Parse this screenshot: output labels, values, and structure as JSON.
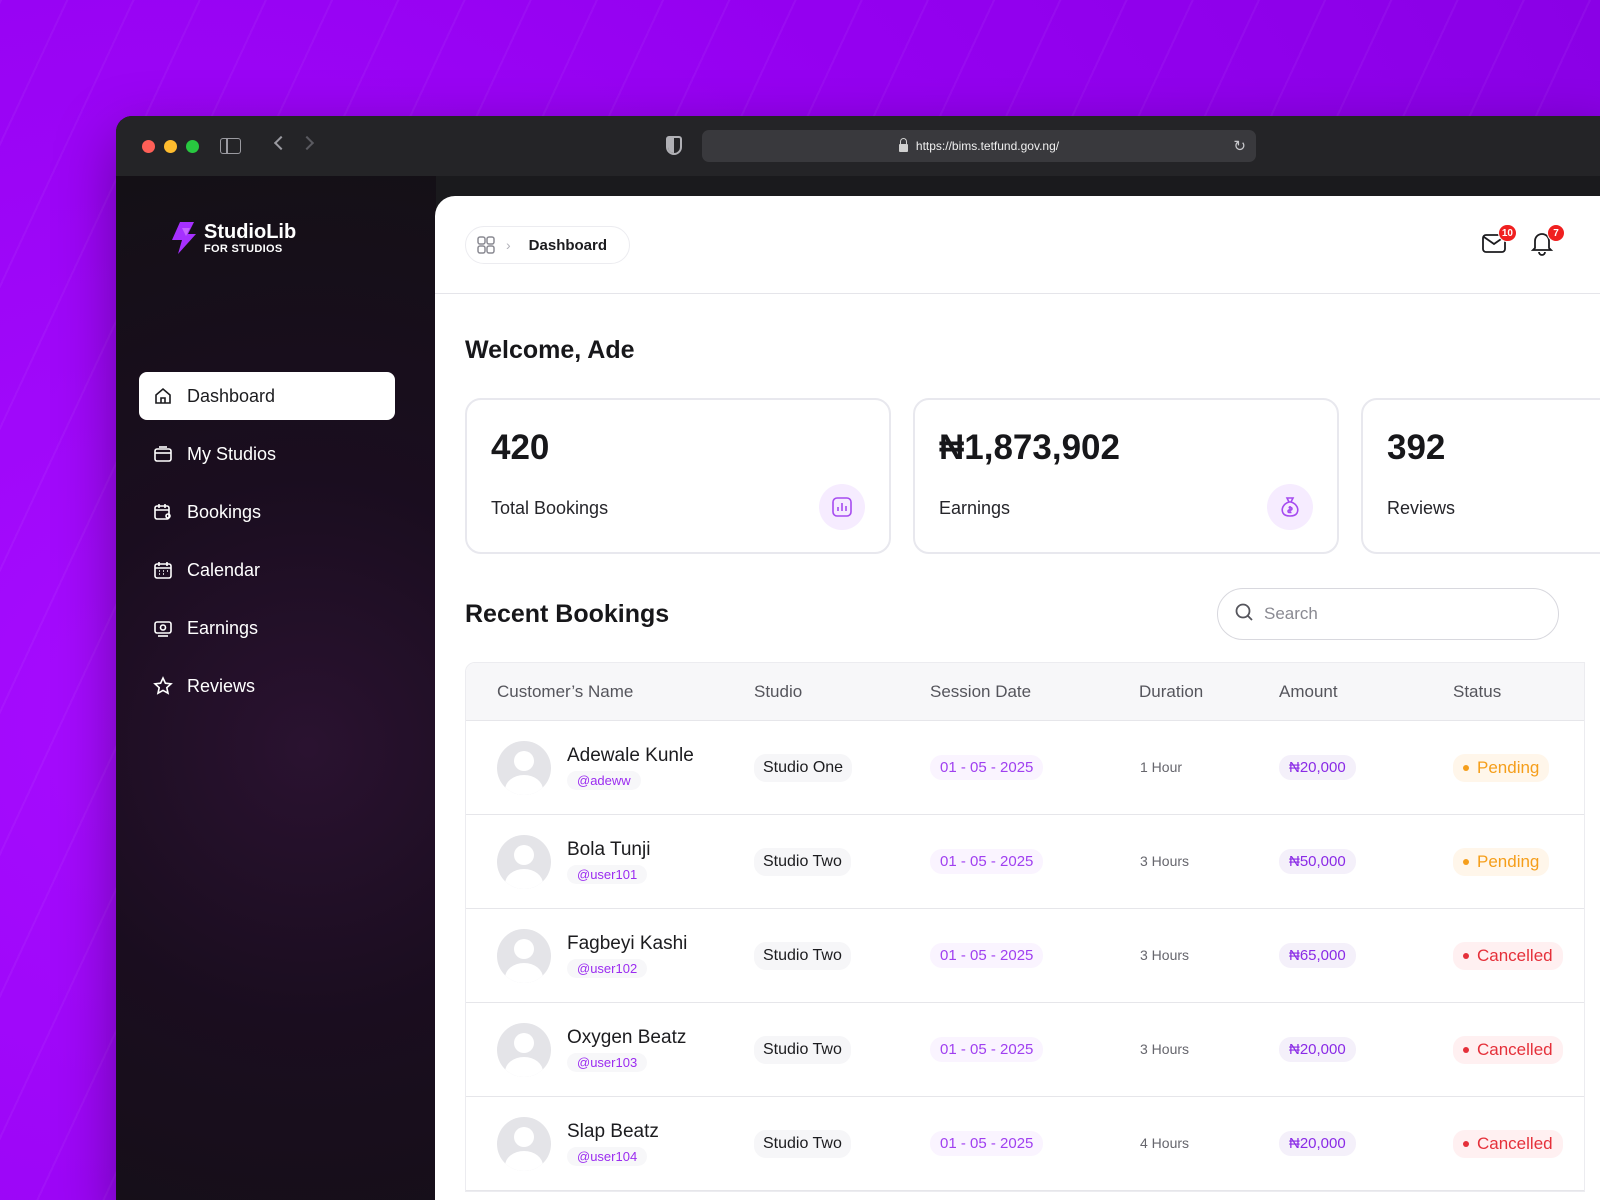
{
  "browser": {
    "url": "https://bims.tetfund.gov.ng/"
  },
  "brand": {
    "name": "StudioLib",
    "tagline": "FOR STUDIOS",
    "color": "#9c00f8"
  },
  "sidebar": {
    "items": [
      {
        "label": "Dashboard",
        "icon": "home-icon",
        "active": true
      },
      {
        "label": "My Studios",
        "icon": "studio-icon"
      },
      {
        "label": "Bookings",
        "icon": "calendar-user-icon"
      },
      {
        "label": "Calendar",
        "icon": "calendar-icon"
      },
      {
        "label": "Earnings",
        "icon": "wallet-icon"
      },
      {
        "label": "Reviews",
        "icon": "star-icon"
      }
    ]
  },
  "header": {
    "breadcrumb": "Dashboard",
    "mail_count": "10",
    "notification_count": "7"
  },
  "welcome": "Welcome, Ade",
  "stats": [
    {
      "value": "420",
      "label": "Total Bookings",
      "icon": "bar-chart-icon"
    },
    {
      "value": "₦1,873,902",
      "label": "Earnings",
      "icon": "money-bag-icon"
    },
    {
      "value": "392",
      "label": "Reviews"
    }
  ],
  "recent": {
    "title": "Recent Bookings",
    "search_placeholder": "Search",
    "columns": [
      "Customer’s Name",
      "Studio",
      "Session Date",
      "Duration",
      "Amount",
      "Status"
    ],
    "rows": [
      {
        "name": "Adewale Kunle",
        "handle": "@adeww",
        "studio": "Studio One",
        "date": "01 - 05 - 2025",
        "duration": "1 Hour",
        "amount": "₦20,000",
        "status": "Pending"
      },
      {
        "name": "Bola Tunji",
        "handle": "@user101",
        "studio": "Studio Two",
        "date": "01 - 05 - 2025",
        "duration": "3 Hours",
        "amount": "₦50,000",
        "status": "Pending"
      },
      {
        "name": "Fagbeyi Kashi",
        "handle": "@user102",
        "studio": "Studio Two",
        "date": "01 - 05 - 2025",
        "duration": "3 Hours",
        "amount": "₦65,000",
        "status": "Cancelled"
      },
      {
        "name": "Oxygen Beatz",
        "handle": "@user103",
        "studio": "Studio Two",
        "date": "01 - 05 - 2025",
        "duration": "3 Hours",
        "amount": "₦20,000",
        "status": "Cancelled"
      },
      {
        "name": "Slap Beatz",
        "handle": "@user104",
        "studio": "Studio Two",
        "date": "01 - 05 - 2025",
        "duration": "4 Hours",
        "amount": "₦20,000",
        "status": "Cancelled"
      }
    ]
  }
}
